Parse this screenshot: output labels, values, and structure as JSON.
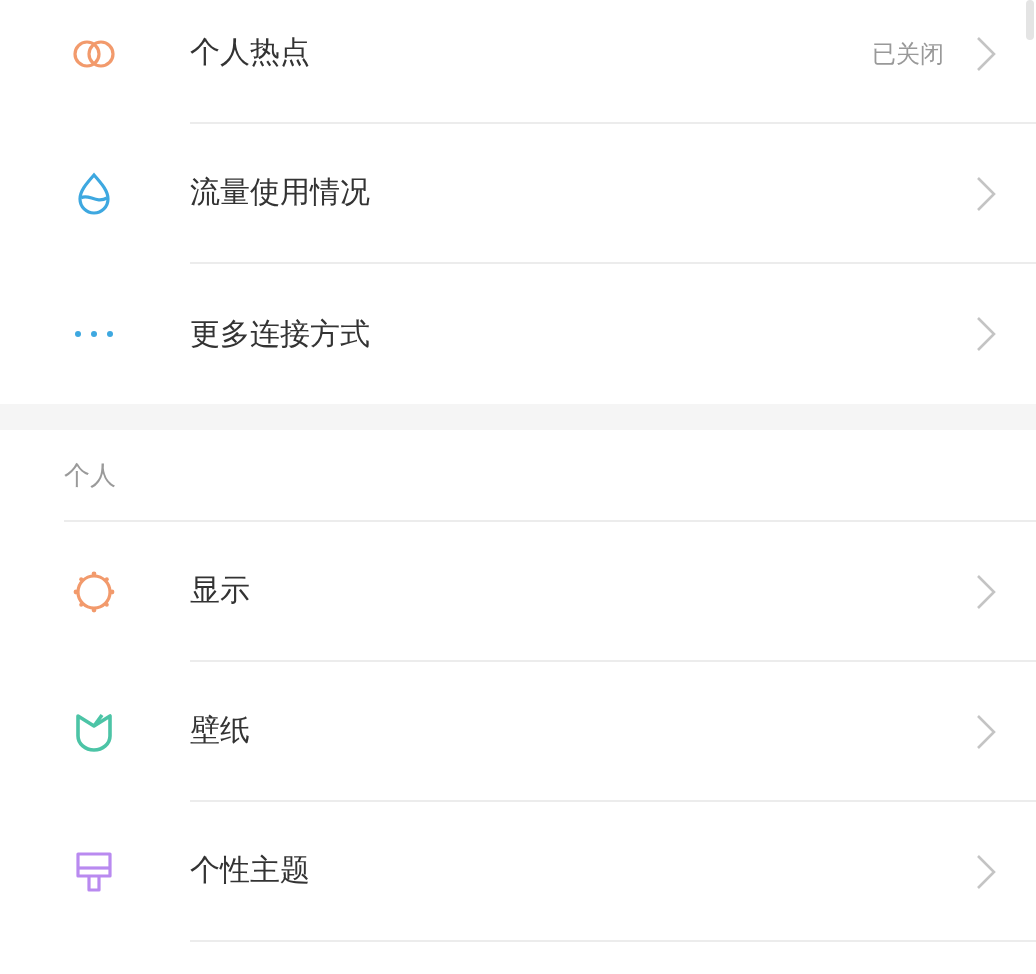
{
  "sections": [
    {
      "items": [
        {
          "label": "个人热点",
          "value": "已关闭"
        },
        {
          "label": "流量使用情况"
        },
        {
          "label": "更多连接方式"
        }
      ]
    },
    {
      "header": "个人",
      "items": [
        {
          "label": "显示"
        },
        {
          "label": "壁纸"
        },
        {
          "label": "个性主题"
        }
      ]
    }
  ]
}
